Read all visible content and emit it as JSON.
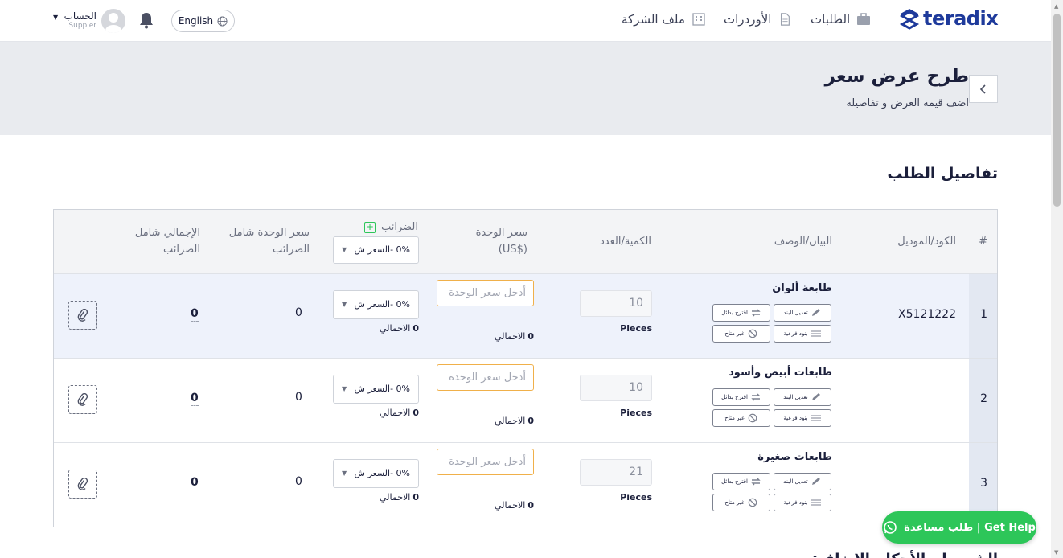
{
  "brand": {
    "name": "teradix",
    "color": "#1e3a9b"
  },
  "nav": {
    "requests": "الطلبات",
    "orders": "الأوردرات",
    "company_profile": "ملف الشركة",
    "language": "English",
    "account_name": "الحساب",
    "account_role": "Suppier"
  },
  "header": {
    "title": "طرح عرض سعر",
    "subtitle": "اضف قيمه العرض و تفاصيله"
  },
  "section_title": "تفاصيل الطلب",
  "table": {
    "headers": {
      "index": "#",
      "code": "الكود/الموديل",
      "description": "البيان/الوصف",
      "quantity": "الكمية/العدد",
      "unit_price": "سعر الوحدة",
      "unit_price_currency": "($US)",
      "taxes": "الضرائب",
      "tax_header_select": "0% -السعر ش",
      "unit_price_incl_tax_line1": "سعر الوحدة شامل",
      "unit_price_incl_tax_line2": "الضرائب",
      "total_incl_tax_line1": "الإجمالي شامل",
      "total_incl_tax_line2": "الضرائب"
    },
    "action_labels": {
      "edit_item": "تعديل البند",
      "suggest_alternative": "اقترح بدائل",
      "sub_items": "بنود فرعية",
      "unavailable": "غير متاح"
    },
    "price_placeholder": "أدخل سعر الوحدة",
    "total_label": "الاجمالي",
    "rows": [
      {
        "index": "1",
        "code": "X5121222",
        "description": "طابعة ألوان",
        "quantity": "10",
        "unit": "Pieces",
        "price_total": "0",
        "tax_option": "0% -السعر ش",
        "tax_total": "0",
        "unit_price_incl_tax": "0",
        "total_incl_tax": "0"
      },
      {
        "index": "2",
        "code": "",
        "description": "طابعات أبيض وأسود",
        "quantity": "10",
        "unit": "Pieces",
        "price_total": "0",
        "tax_option": "0% -السعر ش",
        "tax_total": "0",
        "unit_price_incl_tax": "0",
        "total_incl_tax": "0"
      },
      {
        "index": "3",
        "code": "",
        "description": "طابعات صغيرة",
        "quantity": "21",
        "unit": "Pieces",
        "price_total": "0",
        "tax_option": "0% -السعر ش",
        "tax_total": "0",
        "unit_price_incl_tax": "0",
        "total_incl_tax": "0"
      }
    ]
  },
  "help_button": "Get Help | طلب مساعدة",
  "bottom_peek": "الشروط والأحكام الإضافية"
}
